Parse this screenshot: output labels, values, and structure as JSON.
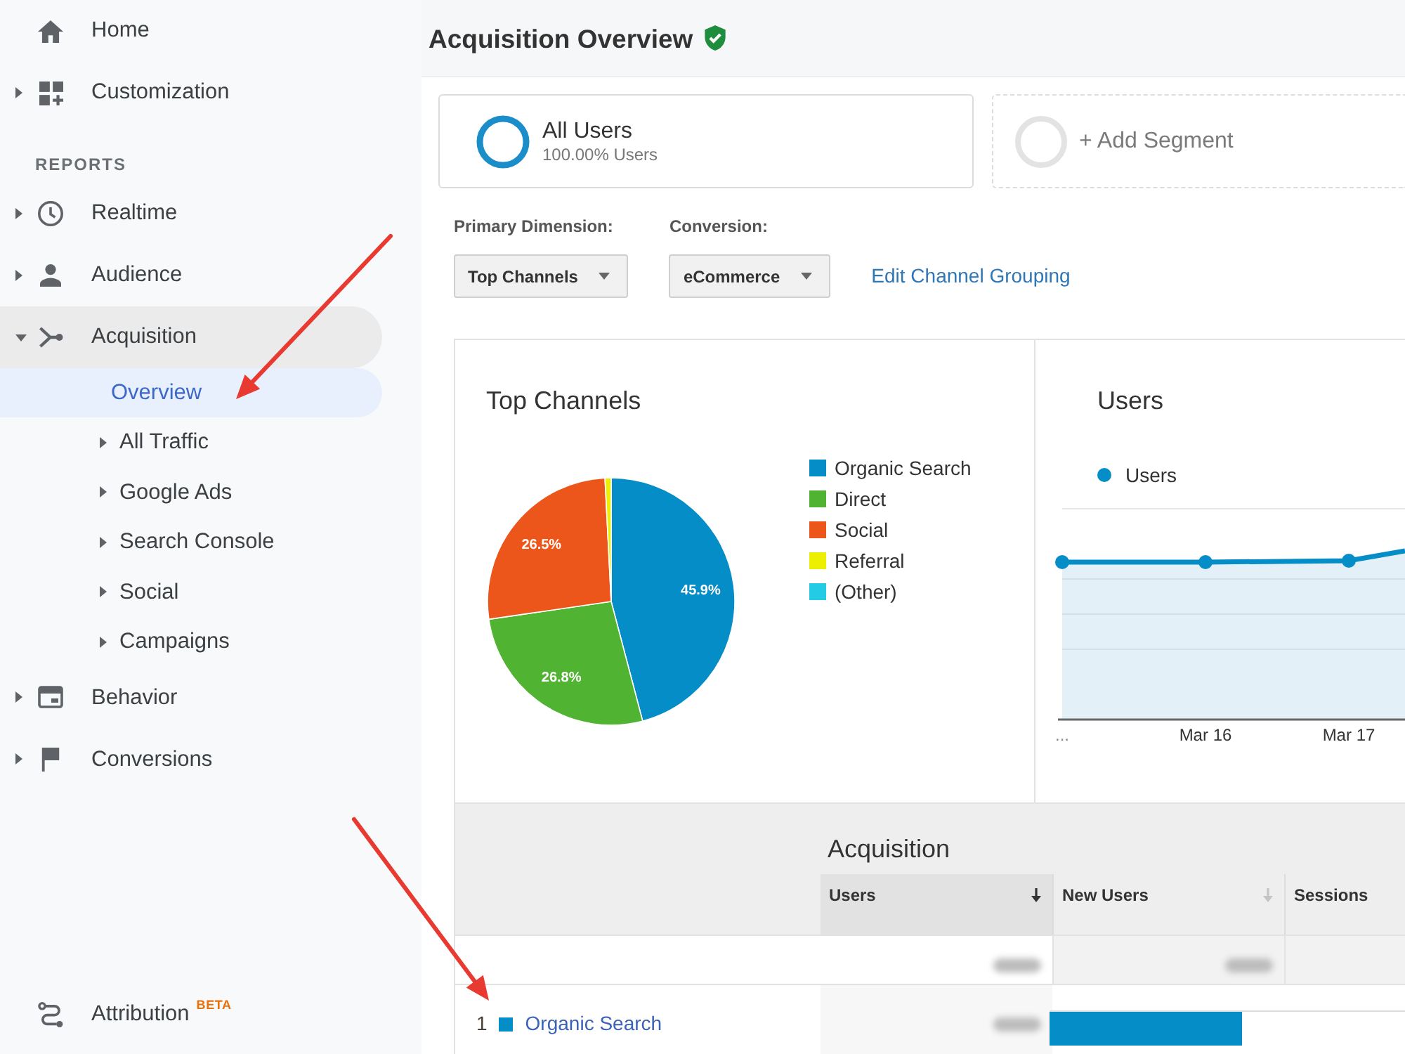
{
  "sidebar": {
    "top_items": [
      {
        "kind": "page",
        "label": "Home",
        "selected": false
      },
      {
        "kind": "folder",
        "label": "Customization",
        "expanded": false,
        "selected": false
      }
    ],
    "section_label": "REPORTS",
    "report_items": [
      {
        "kind": "folder",
        "label": "Realtime",
        "expanded": false,
        "selected": false
      },
      {
        "kind": "folder",
        "label": "Audience",
        "expanded": false,
        "selected": false
      },
      {
        "kind": "folder",
        "label": "Acquisition",
        "expanded": true,
        "selected": false,
        "children": [
          {
            "kind": "page",
            "label": "Overview",
            "selected": true
          },
          {
            "kind": "folder",
            "label": "All Traffic",
            "expanded": false,
            "selected": false
          },
          {
            "kind": "folder",
            "label": "Google Ads",
            "expanded": false,
            "selected": false
          },
          {
            "kind": "folder",
            "label": "Search Console",
            "expanded": false,
            "selected": false
          },
          {
            "kind": "folder",
            "label": "Social",
            "expanded": false,
            "selected": false
          },
          {
            "kind": "folder",
            "label": "Campaigns",
            "expanded": false,
            "selected": false
          }
        ]
      },
      {
        "kind": "folder",
        "label": "Behavior",
        "expanded": false,
        "selected": false
      },
      {
        "kind": "folder",
        "label": "Conversions",
        "expanded": false,
        "selected": false
      }
    ],
    "footer_item": {
      "kind": "page",
      "label": "Attribution",
      "badge": "BETA",
      "selected": false
    }
  },
  "page_title": "Acquisition Overview",
  "segments": [
    {
      "kind": "segment",
      "name": "All Users",
      "detail": "100.00% Users"
    },
    {
      "kind": "add",
      "name": "+ Add Segment"
    }
  ],
  "filters": [
    {
      "label": "Primary Dimension:",
      "value": "Top Channels"
    },
    {
      "label": "Conversion:",
      "value": "eCommerce"
    }
  ],
  "edit_link": "Edit Channel Grouping",
  "pie_panel": {
    "chart_data": {
      "type": "pie",
      "title": "Top Channels",
      "categories": [
        "Organic Search",
        "Direct",
        "Social",
        "Referral",
        "(Other)"
      ],
      "values": [
        45.9,
        26.8,
        26.5,
        0.8,
        0
      ],
      "value_labels": [
        "45.9%",
        "26.8%",
        "26.5%",
        null,
        null
      ],
      "legend": true
    },
    "legend_entries": [
      {
        "color": "#058dc7"
      },
      {
        "color": "#50b432"
      },
      {
        "color": "#ed561b"
      },
      {
        "color": "#edef00"
      },
      {
        "color": "#24cbe5"
      }
    ]
  },
  "users_panel": {
    "title": "Users",
    "legend": "Users",
    "x_labels": [
      "...",
      "Mar 16",
      "Mar 17"
    ]
  },
  "table": {
    "group_heading": "Acquisition",
    "columns": [
      {
        "label": "Users",
        "sorted": true
      },
      {
        "label": "New Users",
        "sorted": false
      },
      {
        "label": "Sessions"
      }
    ],
    "rows": [
      {
        "kind": "totals"
      },
      {
        "kind": "channel",
        "rank": "1",
        "label": "Organic Search",
        "color": "#058dc7",
        "level": 0.54
      }
    ]
  }
}
